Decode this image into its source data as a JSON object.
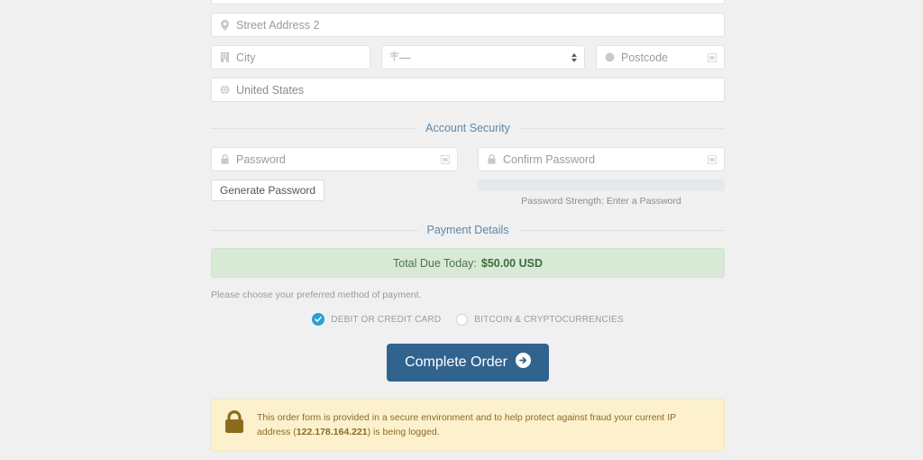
{
  "address": {
    "street2_placeholder": "Street Address 2",
    "city_placeholder": "City",
    "state_value": "—",
    "postcode_placeholder": "Postcode",
    "country_value": "United States"
  },
  "account_security": {
    "legend": "Account Security",
    "password_placeholder": "Password",
    "confirm_placeholder": "Confirm Password",
    "generate_label": "Generate Password",
    "strength_caption": "Password Strength: Enter a Password"
  },
  "payment": {
    "legend": "Payment Details",
    "total_label": "Total Due Today:",
    "total_amount": "$50.00 USD",
    "helper": "Please choose your preferred method of payment.",
    "methods": [
      {
        "label": "DEBIT OR CREDIT CARD",
        "selected": true
      },
      {
        "label": "BITCOIN & CRYPTOCURRENCIES",
        "selected": false
      }
    ]
  },
  "submit": {
    "label": "Complete Order"
  },
  "notice": {
    "text_before": "This order form is provided in a secure environment and to help protect against fraud your current IP address (",
    "ip": "122.178.164.221",
    "text_after": ") is being logged."
  },
  "colors": {
    "page_bg": "#f0f0f0",
    "legend_blue": "#5e87a8",
    "total_bg": "#d8ead6",
    "cta_blue": "#31638f",
    "radio_blue": "#2a9fd8",
    "notice_bg": "#fcf0cd",
    "lock_gold": "#8a6d1b"
  }
}
